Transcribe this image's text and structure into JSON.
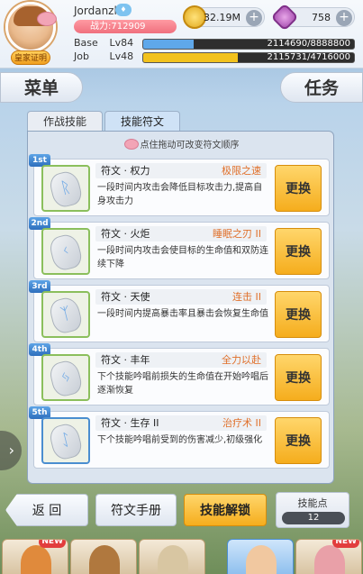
{
  "player": {
    "name": "Jordanzl",
    "power": "战力:712909",
    "badge": "皇家证明",
    "base": {
      "label": "Base",
      "level": "Lv84",
      "exp": "2114690/8888800",
      "progress": 0.238
    },
    "job": {
      "label": "Job",
      "level": "Lv48",
      "exp": "2115731/4716000",
      "progress": 0.449
    }
  },
  "currency": {
    "zeny": {
      "amount": "32.19M",
      "icon": "zeny-coin-icon"
    },
    "gems": {
      "amount": "758",
      "icon": "gem-icon"
    }
  },
  "nav": {
    "menu": "菜单",
    "task": "任务"
  },
  "tabs": {
    "combat": "作战技能",
    "runes": "技能符文"
  },
  "hint": "点住拖动可改变符文顺序",
  "runes": [
    {
      "rank": "1st",
      "name": "符文 · 权力",
      "skill": "极限之速",
      "desc": "一段时间内攻击会降低目标攻击力,提高自身攻击力",
      "button": "更换",
      "glyph": "ᚱ"
    },
    {
      "rank": "2nd",
      "name": "符文 · 火炬",
      "skill": "睡眠之刃 II",
      "desc": "一段时间内攻击会使目标的生命值和双防连续下降",
      "button": "更换",
      "glyph": "ᚲ"
    },
    {
      "rank": "3rd",
      "name": "符文 · 天使",
      "skill": "连击 II",
      "desc": "一段时间内提高暴击率且暴击会恢复生命值",
      "button": "更换",
      "glyph": "ᛉ"
    },
    {
      "rank": "4th",
      "name": "符文 · 丰年",
      "skill": "全力以赴",
      "desc": "下个技能吟唱前损失的生命值在开始吟唱后逐渐恢复",
      "button": "更换",
      "glyph": "ᛃ"
    },
    {
      "rank": "5th",
      "name": "符文 · 生存 II",
      "skill": "治疗术 II",
      "desc": "下个技能吟唱前受到的伤害减少,初级强化",
      "button": "更换",
      "glyph": "ᛇ"
    }
  ],
  "bottom": {
    "back": "返 回",
    "manual": "符文手册",
    "unlock": "技能解锁",
    "skill_points_label": "技能点",
    "skill_points_value": "12"
  },
  "new_badge": "NEW",
  "colors": {
    "accent": "#f5ad1d",
    "skill_name": "#e0702a",
    "base_bar": "#5fa8ea",
    "job_bar": "#f2c21d"
  }
}
